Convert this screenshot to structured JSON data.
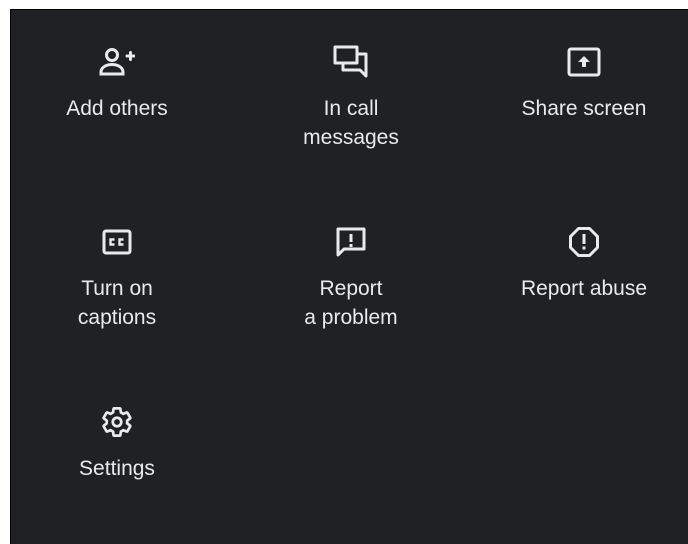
{
  "menu": {
    "items": [
      {
        "id": "add-others",
        "label": "Add others",
        "icon": "person-add-icon"
      },
      {
        "id": "in-call-messages",
        "label": "In call\nmessages",
        "icon": "chat-icon"
      },
      {
        "id": "share-screen",
        "label": "Share screen",
        "icon": "present-to-all-icon"
      },
      {
        "id": "captions",
        "label": "Turn on\ncaptions",
        "icon": "closed-caption-icon"
      },
      {
        "id": "report-problem",
        "label": "Report\na problem",
        "icon": "feedback-icon"
      },
      {
        "id": "report-abuse",
        "label": "Report abuse",
        "icon": "report-octagon-icon"
      },
      {
        "id": "settings",
        "label": "Settings",
        "icon": "gear-icon"
      }
    ]
  },
  "colors": {
    "background": "#202124",
    "foreground": "#e8eaed"
  }
}
